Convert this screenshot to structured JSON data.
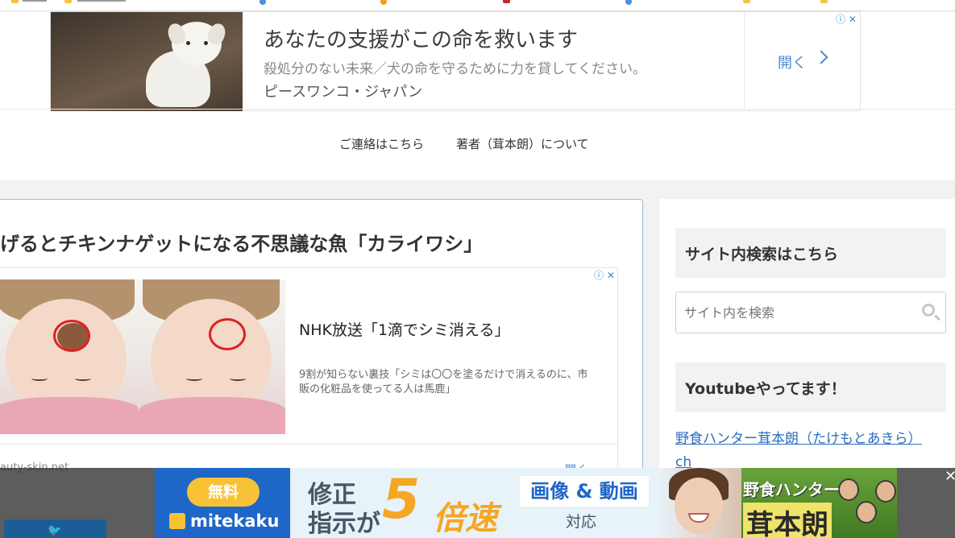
{
  "top_ad": {
    "title": "あなたの支援がこの命を救います",
    "description": "殺処分のない未来／犬の命を守るために力を貸してください。",
    "sponsor": "ピースワンコ・ジャパン",
    "open_label": "開く",
    "adchoices": "ⓘ ✕"
  },
  "nav": {
    "contact": "ご連絡はこちら",
    "about": "著者（茸本朗）について"
  },
  "article": {
    "title": "げるとチキンナゲットになる不思議な魚「カライワシ」"
  },
  "inline_ad": {
    "title": "NHK放送「1滴でシミ消える」",
    "description": "9割が知らない裏技「シミは〇〇を塗るだけで消えるのに、市販の化粧品を使ってる人は馬鹿」",
    "domain": "auty-skin.net",
    "open_label": "開く",
    "adchoices": "ⓘ ✕"
  },
  "sidebar": {
    "search_heading": "サイト内検索はこちら",
    "search_placeholder": "サイト内を検索",
    "youtube_heading": "Youtubeやってます！",
    "youtube_link_line1": "野食ハンター茸本朗（たけもとあきら）",
    "youtube_link_line2": "ch"
  },
  "bottom_banner": {
    "free": "無料",
    "brand": "mitekaku",
    "line1": "修正",
    "line2": "指示が",
    "number": "5",
    "speed": "倍速",
    "media": "画像 & 動画",
    "support": "対応"
  },
  "hunter_banner": {
    "title": "野食ハンター",
    "name": "茸本朗"
  },
  "close": "✕",
  "colors": {
    "link": "#2a6ebf",
    "ad_blue": "#4a8ad0",
    "banner_blue": "#1e66c8",
    "banner_orange": "#f5a623"
  }
}
